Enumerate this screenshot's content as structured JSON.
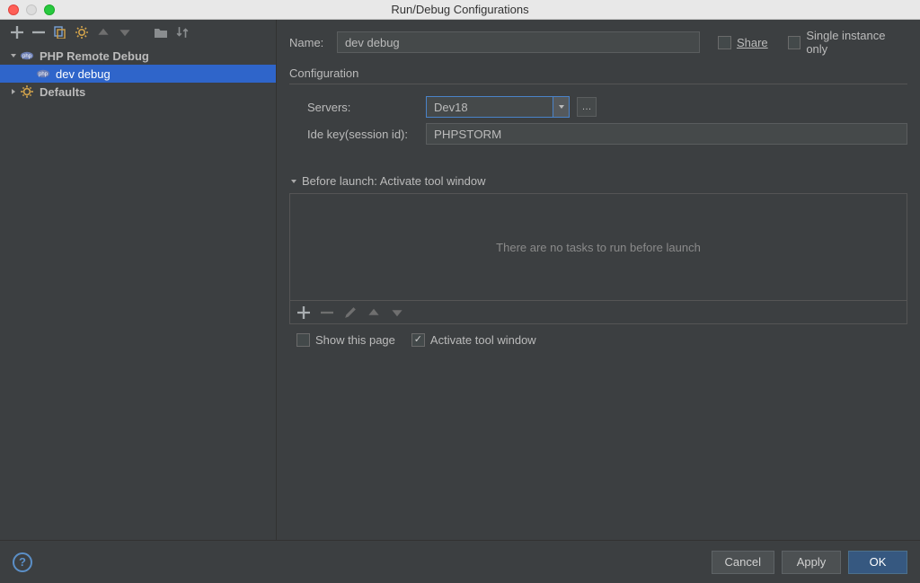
{
  "window": {
    "title": "Run/Debug Configurations"
  },
  "sidebar": {
    "categories": [
      {
        "label": "PHP Remote Debug",
        "expanded": true,
        "children": [
          {
            "label": "dev debug",
            "selected": true
          }
        ]
      },
      {
        "label": "Defaults",
        "expanded": false
      }
    ]
  },
  "form": {
    "name_label": "Name:",
    "name_value": "dev debug",
    "share_label": "Share",
    "share_checked": false,
    "single_instance_label": "Single instance only",
    "single_instance_checked": false
  },
  "configuration": {
    "title": "Configuration",
    "servers_label": "Servers:",
    "servers_value": "Dev18",
    "idekey_label": "Ide key(session id):",
    "idekey_value": "PHPSTORM"
  },
  "before_launch": {
    "header": "Before launch: Activate tool window",
    "empty_text": "There are no tasks to run before launch",
    "show_page_label": "Show this page",
    "show_page_checked": false,
    "activate_label": "Activate tool window",
    "activate_checked": true
  },
  "buttons": {
    "cancel": "Cancel",
    "apply": "Apply",
    "ok": "OK"
  }
}
